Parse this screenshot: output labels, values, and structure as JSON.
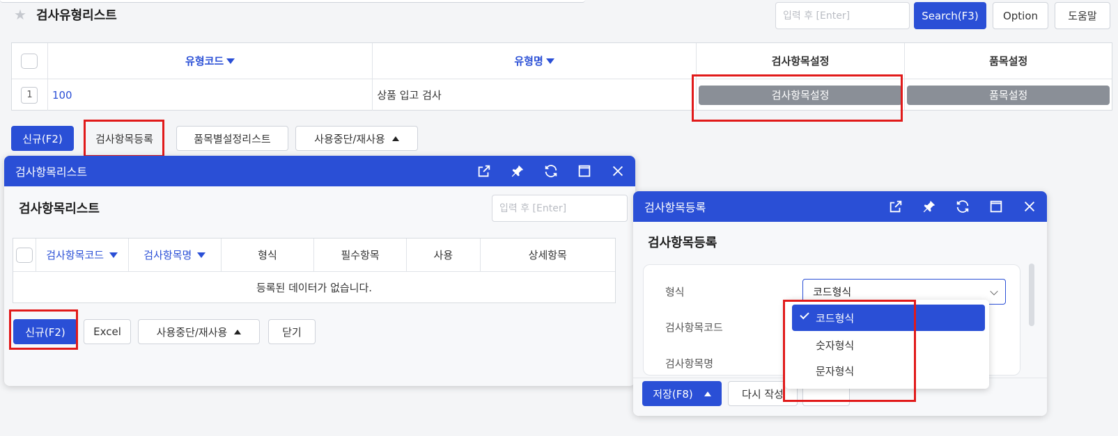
{
  "page": {
    "title": "검사유형리스트",
    "search_placeholder": "입력 후 [Enter]",
    "search_button": "Search(F3)",
    "option_button": "Option",
    "help_button": "도움말"
  },
  "main_grid": {
    "columns": [
      "유형코드",
      "유형명",
      "검사항목설정",
      "품목설정"
    ],
    "rows": [
      {
        "num": "1",
        "code": "100",
        "name": "상품 입고 검사",
        "item_setting": "검사항목설정",
        "product_setting": "품목설정"
      }
    ]
  },
  "action_bar": {
    "new": "신규(F2)",
    "register_items": "검사항목등록",
    "by_product_list": "품목별설정리스트",
    "suspend_reuse": "사용중단/재사용"
  },
  "item_list_dialog": {
    "bar_title": "검사항목리스트",
    "title": "검사항목리스트",
    "search_placeholder": "입력 후 [Enter]",
    "columns": [
      "검사항목코드",
      "검사항목명",
      "형식",
      "필수항목",
      "사용",
      "상세항목"
    ],
    "empty_message": "등록된 데이터가 없습니다.",
    "buttons": {
      "new": "신규(F2)",
      "excel": "Excel",
      "suspend_reuse": "사용중단/재사용",
      "close": "닫기"
    }
  },
  "item_register_dialog": {
    "bar_title": "검사항목등록",
    "title": "검사항목등록",
    "labels": {
      "format": "형식",
      "code": "검사항목코드",
      "name": "검사항목명"
    },
    "format_value": "코드형식",
    "format_options": [
      "코드형식",
      "숫자형식",
      "문자형식"
    ],
    "buttons": {
      "save": "저장(F8)",
      "rewrite": "다시 작성"
    }
  },
  "colors": {
    "primary": "#2a4fd6",
    "highlight": "#e11a1a",
    "grey_button": "#8a8f97"
  },
  "icons": [
    "star-icon",
    "external-link-icon",
    "pin-icon",
    "refresh-icon",
    "maximize-icon",
    "close-icon",
    "chevron-down-icon",
    "check-icon"
  ]
}
